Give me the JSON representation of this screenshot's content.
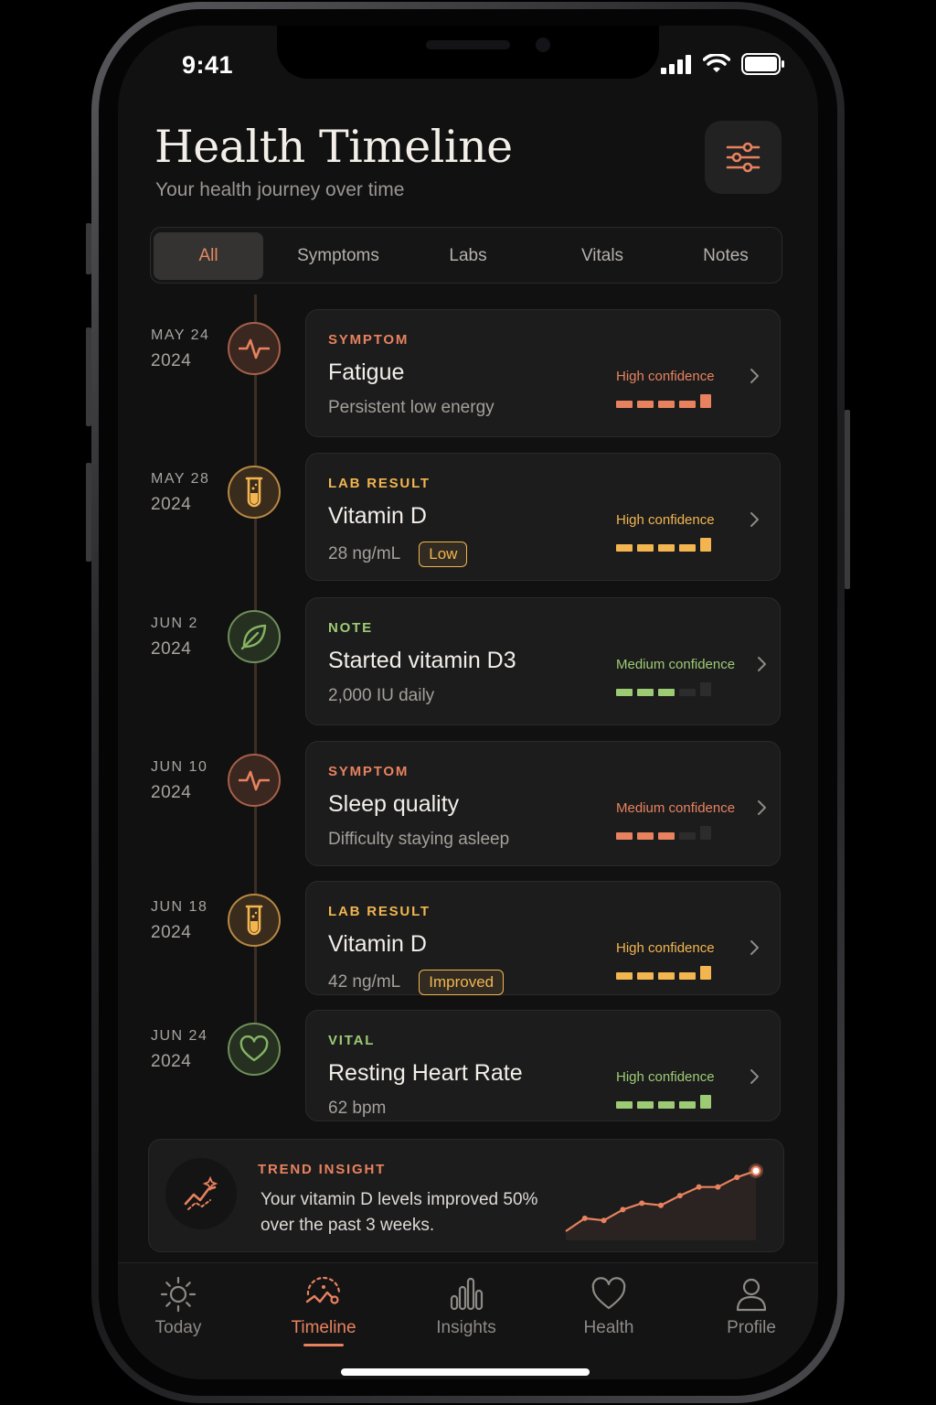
{
  "status": {
    "time": "9:41"
  },
  "header": {
    "title": "Health Timeline",
    "subtitle": "Your health journey over time"
  },
  "tabs": [
    {
      "label": "All",
      "active": true
    },
    {
      "label": "Symptoms"
    },
    {
      "label": "Labs"
    },
    {
      "label": "Vitals"
    },
    {
      "label": "Notes"
    }
  ],
  "events": [
    {
      "month": "MAY 24",
      "year": "2024",
      "category": "SYMPTOM",
      "title": "Fatigue",
      "detail": "Persistent low energy",
      "badge": "",
      "confidence": "High confidence",
      "level": 5,
      "icon": "pulse-icon",
      "color": "#e8825e"
    },
    {
      "month": "MAY 28",
      "year": "2024",
      "category": "LAB RESULT",
      "title": "Vitamin D",
      "detail": "28 ng/mL",
      "badge": "Low",
      "confidence": "High confidence",
      "level": 5,
      "icon": "test-tube-icon",
      "color": "#f2b54f"
    },
    {
      "month": "JUN 2",
      "year": "2024",
      "category": "NOTE",
      "title": "Started vitamin D3",
      "detail": "2,000 IU daily",
      "badge": "",
      "confidence": "Medium confidence",
      "level": 3,
      "icon": "leaf-icon",
      "color": "#9dcb74"
    },
    {
      "month": "JUN 10",
      "year": "2024",
      "category": "SYMPTOM",
      "title": "Sleep quality",
      "detail": "Difficulty staying asleep",
      "badge": "",
      "confidence": "Medium confidence",
      "level": 3,
      "icon": "pulse-icon",
      "color": "#e8825e"
    },
    {
      "month": "JUN 18",
      "year": "2024",
      "category": "LAB RESULT",
      "title": "Vitamin D",
      "detail": "42 ng/mL",
      "badge": "Improved",
      "confidence": "High confidence",
      "level": 5,
      "icon": "test-tube-icon",
      "color": "#f2b54f"
    },
    {
      "month": "JUN 24",
      "year": "2024",
      "category": "VITAL",
      "title": "Resting Heart Rate",
      "detail": "62 bpm",
      "badge": "",
      "confidence": "High confidence",
      "level": 5,
      "icon": "heart-icon",
      "color": "#9dcb74"
    }
  ],
  "insight": {
    "label": "TREND INSIGHT",
    "text": "Your vitamin D levels improved 50% over the past 3 weeks.",
    "trend": [
      0,
      1.2,
      1.0,
      2.0,
      2.6,
      2.4,
      3.3,
      4.1,
      4.1,
      5.0,
      5.6
    ]
  },
  "nav": [
    {
      "label": "Today",
      "icon": "sun-icon"
    },
    {
      "label": "Timeline",
      "icon": "timeline-icon",
      "active": true
    },
    {
      "label": "Insights",
      "icon": "bar-chart-icon"
    },
    {
      "label": "Health",
      "icon": "heart-icon"
    },
    {
      "label": "Profile",
      "icon": "person-icon"
    }
  ],
  "colors": {
    "accent": "#e8825e",
    "lab": "#f2b54f",
    "note": "#9dcb74",
    "background": "#111112"
  }
}
